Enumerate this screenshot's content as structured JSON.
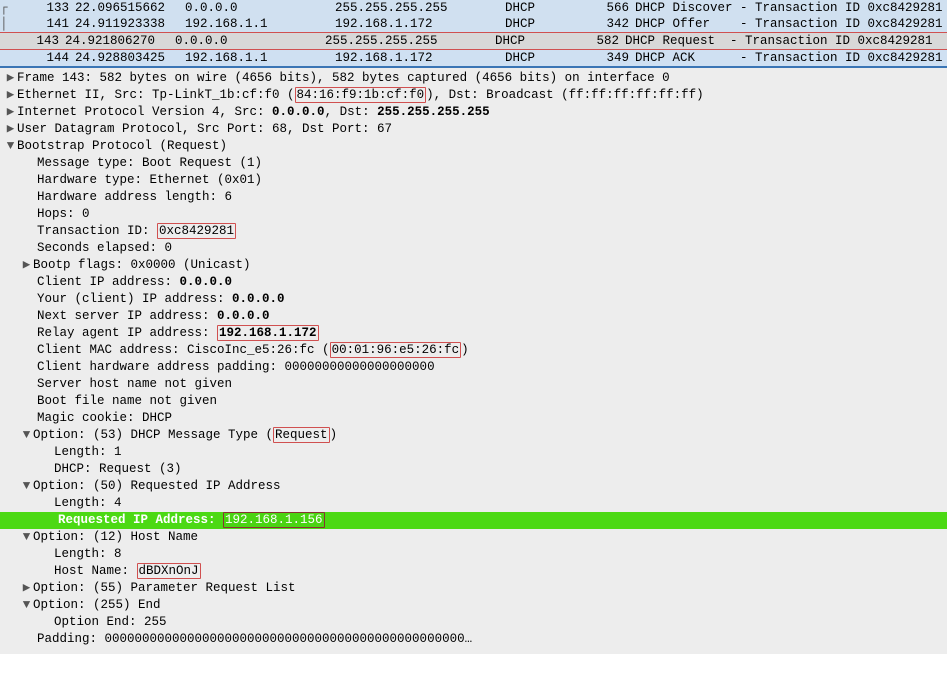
{
  "packets": [
    {
      "no": "133",
      "time": "22.096515662",
      "src": "0.0.0.0",
      "dst": "255.255.255.255",
      "proto": "DHCP",
      "len": "566",
      "info": "DHCP Discover - Transaction ID 0xc8429281"
    },
    {
      "no": "141",
      "time": "24.911923338",
      "src": "192.168.1.1",
      "dst": "192.168.1.172",
      "proto": "DHCP",
      "len": "342",
      "info": "DHCP Offer    - Transaction ID 0xc8429281"
    },
    {
      "no": "143",
      "time": "24.921806270",
      "src": "0.0.0.0",
      "dst": "255.255.255.255",
      "proto": "DHCP",
      "len": "582",
      "info": "DHCP Request  - Transaction ID 0xc8429281"
    },
    {
      "no": "144",
      "time": "24.928803425",
      "src": "192.168.1.1",
      "dst": "192.168.1.172",
      "proto": "DHCP",
      "len": "349",
      "info": "DHCP ACK      - Transaction ID 0xc8429281"
    }
  ],
  "frame": "Frame 143: 582 bytes on wire (4656 bits), 582 bytes captured (4656 bits) on interface 0",
  "eth": {
    "pre": "Ethernet II, Src: Tp-LinkT_1b:cf:f0 (",
    "mac": "84:16:f9:1b:cf:f0",
    "post": "), Dst: Broadcast (ff:ff:ff:ff:ff:ff)"
  },
  "ip": "Internet Protocol Version 4, Src: 0.0.0.0, Dst: 255.255.255.255",
  "udp": "User Datagram Protocol, Src Port: 68, Dst Port: 67",
  "bootp": "Bootstrap Protocol (Request)",
  "fields": {
    "msgtype": "Message type: Boot Request (1)",
    "hwtype": "Hardware type: Ethernet (0x01)",
    "hwlen": "Hardware address length: 6",
    "hops": "Hops: 0",
    "txid_pre": "Transaction ID: ",
    "txid": "0xc8429281",
    "secs": "Seconds elapsed: 0",
    "flags": "Bootp flags: 0x0000 (Unicast)",
    "cip": "Client IP address: 0.0.0.0",
    "yip": "Your (client) IP address: 0.0.0.0",
    "nip": "Next server IP address: 0.0.0.0",
    "rip_pre": "Relay agent IP address: ",
    "rip": "192.168.1.172",
    "cmac_pre": "Client MAC address: CiscoInc_e5:26:fc (",
    "cmac": "00:01:96:e5:26:fc",
    "cmac_post": ")",
    "pad": "Client hardware address padding: 00000000000000000000",
    "sname": "Server host name not given",
    "bfile": "Boot file name not given",
    "cookie": "Magic cookie: DHCP"
  },
  "opt53": {
    "hdr_pre": "Option: (53) DHCP Message Type (",
    "hdr_val": "Request",
    "hdr_post": ")",
    "len": "Length: 1",
    "dhcp": "DHCP: Request (3)"
  },
  "opt50": {
    "hdr": "Option: (50) Requested IP Address",
    "len": "Length: 4",
    "req_pre": "Requested IP Address: ",
    "req_ip": "192.168.1.156"
  },
  "opt12": {
    "hdr": "Option: (12) Host Name",
    "len": "Length: 8",
    "hn_pre": "Host Name: ",
    "hn": "dBDXnOnJ"
  },
  "opt55": "Option: (55) Parameter Request List",
  "opt255": {
    "hdr": "Option: (255) End",
    "end": "Option End: 255"
  },
  "padding": "Padding: 000000000000000000000000000000000000000000000000…"
}
